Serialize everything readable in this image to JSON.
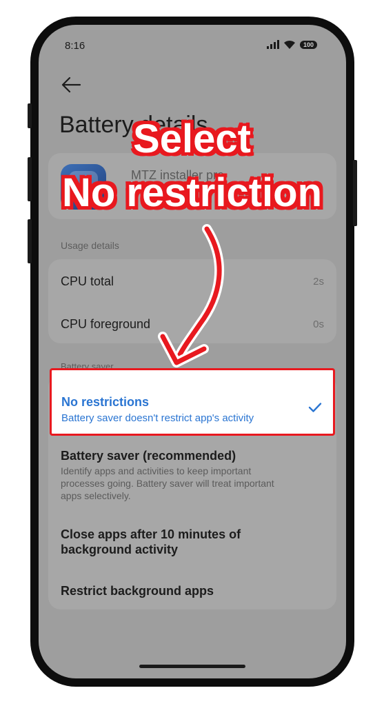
{
  "status_bar": {
    "time": "8:16",
    "battery": "100"
  },
  "page": {
    "title": "Battery details"
  },
  "app": {
    "name": "MTZ installer pro"
  },
  "usage": {
    "section_label": "Usage details",
    "rows": [
      {
        "label": "CPU total",
        "value": "2s"
      },
      {
        "label": "CPU foreground",
        "value": "0s"
      }
    ]
  },
  "battery_saver": {
    "section_label": "Battery saver",
    "options": [
      {
        "title": "No restrictions",
        "description": "Battery saver doesn't restrict app's activity",
        "selected": true
      },
      {
        "title": "Battery saver (recommended)",
        "description": "Identify apps and activities to keep important processes going. Battery saver will treat important apps selectively.",
        "selected": false
      },
      {
        "title": "Close apps after 10 minutes of background activity",
        "description": "",
        "selected": false
      },
      {
        "title": "Restrict background apps",
        "description": "",
        "selected": false
      }
    ]
  },
  "annotation": {
    "line1": "Select",
    "line2": "No restriction"
  },
  "colors": {
    "accent": "#2a75d2",
    "highlight_border": "#e8191f",
    "overlay": "#9e9e9e"
  },
  "icons": [
    "back-arrow-icon",
    "signal-icon",
    "wifi-icon",
    "battery-icon",
    "checkmark-icon",
    "app-icon"
  ]
}
